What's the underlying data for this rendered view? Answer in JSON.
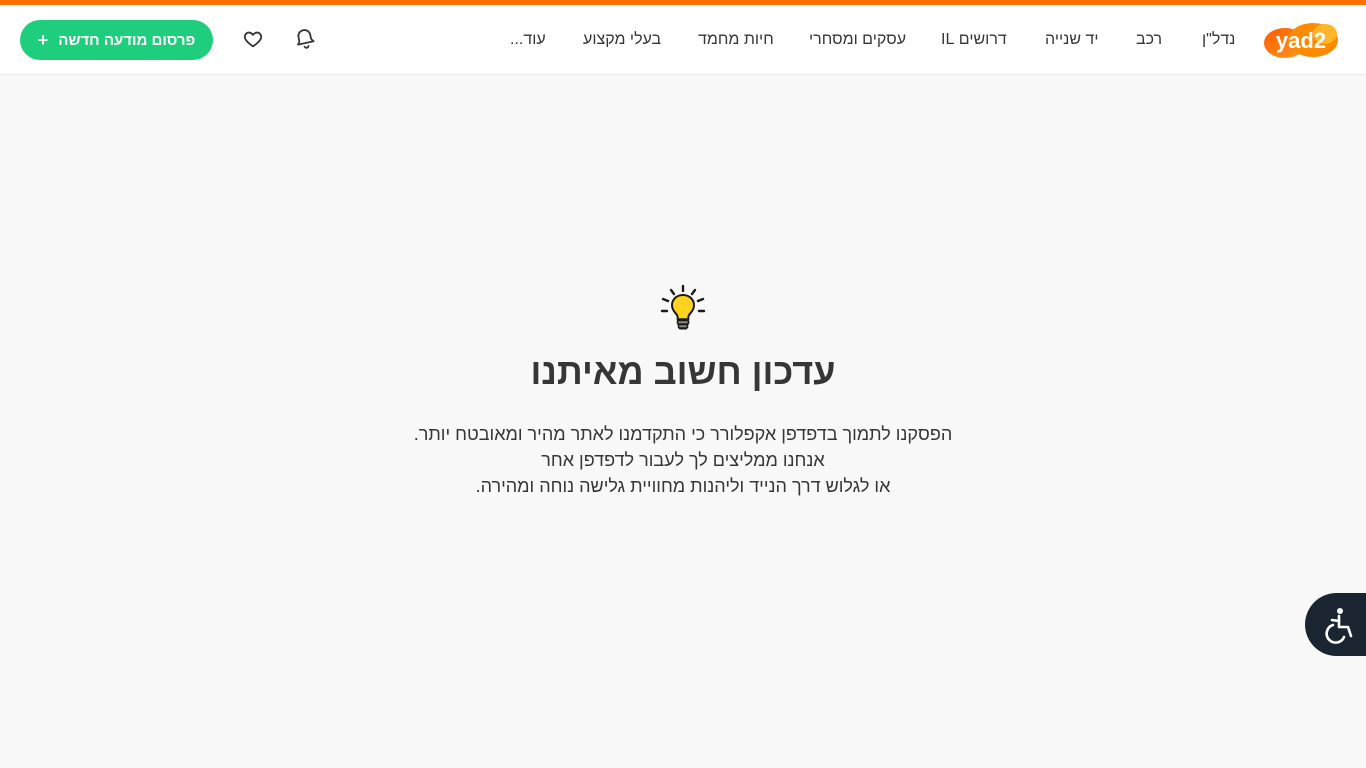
{
  "colors": {
    "accent": "#ff7100",
    "post_button": "#1fce7d",
    "background": "#f8f8f8",
    "text": "#363636",
    "accessibility_bg": "#1b2531"
  },
  "header": {
    "logo_text": "yad2",
    "nav": [
      {
        "label": "נדל\"ן"
      },
      {
        "label": "רכב"
      },
      {
        "label": "יד שנייה"
      },
      {
        "label": "דרושים IL"
      },
      {
        "label": "עסקים ומסחרי"
      },
      {
        "label": "חיות מחמד"
      },
      {
        "label": "בעלי מקצוע"
      },
      {
        "label": "עוד..."
      }
    ],
    "notifications_icon": "bell-icon",
    "favorites_icon": "heart-icon",
    "post_button": {
      "plus": "+",
      "label": "פרסום מודעה חדשה"
    }
  },
  "main": {
    "icon": "lightbulb-icon",
    "title": "עדכון חשוב מאיתנו",
    "lines": [
      "הפסקנו לתמוך בדפדפן אקפלורר כי התקדמנו לאתר מהיר ומאובטח יותר.",
      "אנחנו ממליצים לך לעבור לדפדפן אחר",
      "או לגלוש דרך הנייד וליהנות מחוויית גלישה נוחה ומהירה."
    ]
  },
  "accessibility": {
    "icon": "accessibility-icon"
  }
}
